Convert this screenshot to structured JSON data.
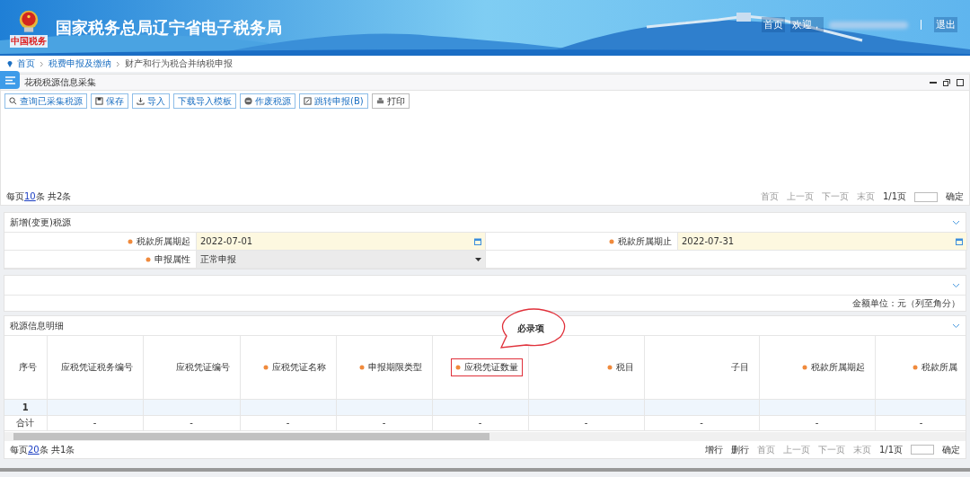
{
  "header": {
    "logo_text": "中国税务",
    "title": "国家税务总局辽宁省电子税务局",
    "nav": [
      {
        "label": "首页"
      },
      {
        "label": "欢迎，"
      }
    ],
    "logout": "退出"
  },
  "breadcrumb": [
    "首页",
    "税费申报及缴纳",
    "财产和行为税合并纳税申报"
  ],
  "panel": {
    "title": "花税税源信息采集",
    "toolbar": [
      {
        "label": "查询已采集税源",
        "kind": "search"
      },
      {
        "label": "保存",
        "kind": "save"
      },
      {
        "label": "导入",
        "kind": "import"
      },
      {
        "label": "下载导入模板",
        "kind": "plain"
      },
      {
        "label": "作废税源",
        "kind": "void"
      },
      {
        "label": "跳转申报(B)",
        "kind": "edit"
      },
      {
        "label": "打印",
        "kind": "print"
      }
    ],
    "pager": {
      "prefix": "每页",
      "size": "10",
      "suffix": "条 共2条",
      "actions": [
        {
          "label": "首页",
          "disabled": true
        },
        {
          "label": "上一页",
          "disabled": true
        },
        {
          "label": "下一页",
          "disabled": true
        },
        {
          "label": "末页",
          "disabled": true
        }
      ],
      "page": "1/1页",
      "confirm": "确定"
    }
  },
  "new_source": {
    "title": "新增(变更)税源",
    "fields": [
      {
        "label": "税款所属期起",
        "required": true,
        "kind": "date",
        "value": "2022-07-01"
      },
      {
        "label": "税款所属期止",
        "required": true,
        "kind": "date",
        "value": "2022-07-31"
      },
      {
        "label": "申报属性",
        "required": true,
        "kind": "select",
        "value": "正常申报"
      }
    ]
  },
  "unit_note": "金额单位：元（列至角分）",
  "detail": {
    "title": "税源信息明细",
    "callout": "必录项",
    "columns": [
      {
        "label": "序号",
        "required": false,
        "highlighted": false
      },
      {
        "label": "应税凭证税务编号",
        "required": false,
        "highlighted": false
      },
      {
        "label": "应税凭证编号",
        "required": false,
        "highlighted": false
      },
      {
        "label": "应税凭证名称",
        "required": true,
        "highlighted": false
      },
      {
        "label": "申报期限类型",
        "required": true,
        "highlighted": false
      },
      {
        "label": "应税凭证数量",
        "required": true,
        "highlighted": true
      },
      {
        "label": "税目",
        "required": true,
        "highlighted": false
      },
      {
        "label": "子目",
        "required": false,
        "highlighted": false
      },
      {
        "label": "税款所属期起",
        "required": true,
        "highlighted": false
      },
      {
        "label": "税款所属",
        "required": true,
        "highlighted": false
      }
    ],
    "rows": [
      [
        "1",
        "",
        "",
        "",
        "",
        "",
        "",
        "",
        "",
        ""
      ],
      [
        "合计",
        "-",
        "-",
        "-",
        "-",
        "-",
        "-",
        "-",
        "-",
        "-"
      ]
    ],
    "pager": {
      "prefix": "每页",
      "size": "20",
      "suffix": "条 共1条",
      "actions": [
        {
          "label": "增行",
          "disabled": false
        },
        {
          "label": "删行",
          "disabled": false
        },
        {
          "label": "首页",
          "disabled": true
        },
        {
          "label": "上一页",
          "disabled": true
        },
        {
          "label": "下一页",
          "disabled": true
        },
        {
          "label": "末页",
          "disabled": true
        }
      ],
      "page": "1/1页",
      "confirm": "确定"
    }
  }
}
